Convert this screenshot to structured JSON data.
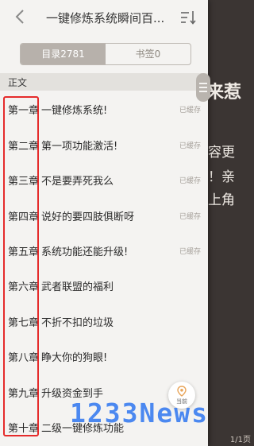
{
  "reader": {
    "fragments": [
      "来惹",
      "容更",
      "！亲",
      "上角"
    ],
    "page_indicator": "1/1页"
  },
  "header": {
    "title": "一键修炼系统瞬间百...",
    "back_icon": "chevron-left-icon",
    "sort_icon": "sort-icon"
  },
  "tabs": [
    {
      "label": "目录2781",
      "active": true
    },
    {
      "label": "书签0",
      "active": false
    }
  ],
  "section": {
    "label": "正文"
  },
  "chapters": [
    {
      "num": "第一章",
      "name": "一键修炼系统!",
      "status": "已缓存"
    },
    {
      "num": "第二章",
      "name": "第一项功能激活!",
      "status": "已缓存"
    },
    {
      "num": "第三章",
      "name": "不是要弄死我么",
      "status": "已缓存"
    },
    {
      "num": "第四章",
      "name": "说好的要四肢俱断呀",
      "status": "已缓存"
    },
    {
      "num": "第五章",
      "name": "系统功能还能升级!",
      "status": "已缓存"
    },
    {
      "num": "第六章",
      "name": "武者联盟的福利",
      "status": ""
    },
    {
      "num": "第七章",
      "name": "不折不扣的垃圾",
      "status": ""
    },
    {
      "num": "第八章",
      "name": "睁大你的狗眼!",
      "status": ""
    },
    {
      "num": "第九章",
      "name": "升级资金到手",
      "status": ""
    },
    {
      "num": "第十章",
      "name": "二级一键修炼功能",
      "status": ""
    }
  ],
  "locate_button": {
    "label": "当前"
  },
  "watermark": {
    "text": "1233News"
  },
  "colors": {
    "highlight_box": "#e52b2b",
    "watermark": "#3d7ff0"
  }
}
